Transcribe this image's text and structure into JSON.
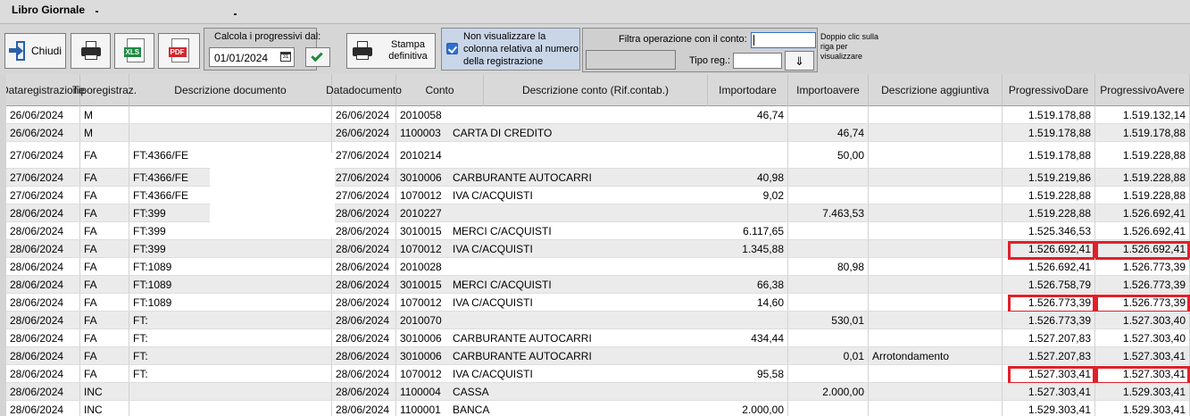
{
  "window": {
    "title": "Libro Giornale"
  },
  "toolbar": {
    "close_label": "Chiudi",
    "xls_tag": "XLS",
    "pdf_tag": "PDF",
    "progressive_group_label": "Calcola i progressivi dal:",
    "progressive_date": "01/01/2024",
    "final_print_label_1": "Stampa",
    "final_print_label_2": "definitiva",
    "hide_column_text_1": "Non visualizzare la",
    "hide_column_text_2": "colonna relativa al numero",
    "hide_column_text_3": "della registrazione",
    "filter_label": "Filtra operazione con il conto:",
    "type_reg_label": "Tipo reg.:",
    "hint_1": "Doppio clic sulla",
    "hint_2": "riga per",
    "hint_3": "visualizzare",
    "icons": [
      "exit-icon",
      "printer-icon",
      "excel-icon",
      "pdf-icon",
      "calendar-icon",
      "check-icon",
      "print-final-icon",
      "filter-icon"
    ]
  },
  "grid": {
    "columns": [
      {
        "l1": "Data",
        "l2": "registrazione"
      },
      {
        "l1": "Tipo",
        "l2": "registraz."
      },
      {
        "l1": "Descrizione documento",
        "l2": ""
      },
      {
        "l1": "Data",
        "l2": "documento"
      },
      {
        "l1": "Conto",
        "l2": ""
      },
      {
        "l1": "Descrizione conto (Rif.contab.)",
        "l2": ""
      },
      {
        "l1": "Importo",
        "l2": "dare"
      },
      {
        "l1": "Importo",
        "l2": "avere"
      },
      {
        "l1": "Descrizione aggiuntiva",
        "l2": ""
      },
      {
        "l1": "Progressivo",
        "l2": "Dare"
      },
      {
        "l1": "Progressivo",
        "l2": "Avere"
      }
    ],
    "rows": [
      {
        "reg": "26/06/2024",
        "tipo": "M",
        "desc": "",
        "doc": "26/06/2024",
        "conto": "2010058",
        "dconto": "",
        "dare": "46,74",
        "avere": "",
        "agg": "",
        "pdare": "1.519.178,88",
        "pavere": "1.519.132,14"
      },
      {
        "reg": "26/06/2024",
        "tipo": "M",
        "desc": "",
        "doc": "26/06/2024",
        "conto": "1100003",
        "dconto": "CARTA DI CREDITO",
        "dare": "",
        "avere": "46,74",
        "agg": "",
        "pdare": "1.519.178,88",
        "pavere": "1.519.178,88"
      },
      {
        "reg": "27/06/2024",
        "tipo": "FA",
        "desc": "FT:4366/FE",
        "doc": "27/06/2024",
        "conto": "2010214",
        "dconto": "",
        "dare": "",
        "avere": "50,00",
        "agg": "",
        "pdare": "1.519.178,88",
        "pavere": "1.519.228,88"
      },
      {
        "reg": "27/06/2024",
        "tipo": "FA",
        "desc": "FT:4366/FE",
        "doc": "27/06/2024",
        "conto": "3010006",
        "dconto": "CARBURANTE AUTOCARRI",
        "dare": "40,98",
        "avere": "",
        "agg": "",
        "pdare": "1.519.219,86",
        "pavere": "1.519.228,88"
      },
      {
        "reg": "27/06/2024",
        "tipo": "FA",
        "desc": "FT:4366/FE",
        "doc": "27/06/2024",
        "conto": "1070012",
        "dconto": "IVA C/ACQUISTI",
        "dare": "9,02",
        "avere": "",
        "agg": "",
        "pdare": "1.519.228,88",
        "pavere": "1.519.228,88"
      },
      {
        "reg": "28/06/2024",
        "tipo": "FA",
        "desc": "FT:399",
        "doc": "28/06/2024",
        "conto": "2010227",
        "dconto": "",
        "dare": "",
        "avere": "7.463,53",
        "agg": "",
        "pdare": "1.519.228,88",
        "pavere": "1.526.692,41"
      },
      {
        "reg": "28/06/2024",
        "tipo": "FA",
        "desc": "FT:399",
        "doc": "28/06/2024",
        "conto": "3010015",
        "dconto": "MERCI C/ACQUISTI",
        "dare": "6.117,65",
        "avere": "",
        "agg": "",
        "pdare": "1.525.346,53",
        "pavere": "1.526.692,41"
      },
      {
        "reg": "28/06/2024",
        "tipo": "FA",
        "desc": "FT:399",
        "doc": "28/06/2024",
        "conto": "1070012",
        "dconto": "IVA C/ACQUISTI",
        "dare": "1.345,88",
        "avere": "",
        "agg": "",
        "pdare": "1.526.692,41",
        "pavere": "1.526.692,41"
      },
      {
        "reg": "28/06/2024",
        "tipo": "FA",
        "desc": "FT:1089",
        "doc": "28/06/2024",
        "conto": "2010028",
        "dconto": "",
        "dare": "",
        "avere": "80,98",
        "agg": "",
        "pdare": "1.526.692,41",
        "pavere": "1.526.773,39"
      },
      {
        "reg": "28/06/2024",
        "tipo": "FA",
        "desc": "FT:1089",
        "doc": "28/06/2024",
        "conto": "3010015",
        "dconto": "MERCI C/ACQUISTI",
        "dare": "66,38",
        "avere": "",
        "agg": "",
        "pdare": "1.526.758,79",
        "pavere": "1.526.773,39"
      },
      {
        "reg": "28/06/2024",
        "tipo": "FA",
        "desc": "FT:1089",
        "doc": "28/06/2024",
        "conto": "1070012",
        "dconto": "IVA C/ACQUISTI",
        "dare": "14,60",
        "avere": "",
        "agg": "",
        "pdare": "1.526.773,39",
        "pavere": "1.526.773,39"
      },
      {
        "reg": "28/06/2024",
        "tipo": "FA",
        "desc": "FT:",
        "doc": "28/06/2024",
        "conto": "2010070",
        "dconto": "",
        "dare": "",
        "avere": "530,01",
        "agg": "",
        "pdare": "1.526.773,39",
        "pavere": "1.527.303,40"
      },
      {
        "reg": "28/06/2024",
        "tipo": "FA",
        "desc": "FT:",
        "doc": "28/06/2024",
        "conto": "3010006",
        "dconto": "CARBURANTE AUTOCARRI",
        "dare": "434,44",
        "avere": "",
        "agg": "",
        "pdare": "1.527.207,83",
        "pavere": "1.527.303,40"
      },
      {
        "reg": "28/06/2024",
        "tipo": "FA",
        "desc": "FT:",
        "doc": "28/06/2024",
        "conto": "3010006",
        "dconto": "CARBURANTE AUTOCARRI",
        "dare": "",
        "avere": "0,01",
        "agg": "Arrotondamento",
        "pdare": "1.527.207,83",
        "pavere": "1.527.303,41"
      },
      {
        "reg": "28/06/2024",
        "tipo": "FA",
        "desc": "FT:",
        "doc": "28/06/2024",
        "conto": "1070012",
        "dconto": "IVA C/ACQUISTI",
        "dare": "95,58",
        "avere": "",
        "agg": "",
        "pdare": "1.527.303,41",
        "pavere": "1.527.303,41"
      },
      {
        "reg": "28/06/2024",
        "tipo": "INC",
        "desc": "",
        "doc": "28/06/2024",
        "conto": "1100004",
        "dconto": "CASSA",
        "dare": "",
        "avere": "2.000,00",
        "agg": "",
        "pdare": "1.527.303,41",
        "pavere": "1.529.303,41"
      },
      {
        "reg": "28/06/2024",
        "tipo": "INC",
        "desc": "",
        "doc": "28/06/2024",
        "conto": "1100001",
        "dconto": "BANCA",
        "dare": "2.000,00",
        "avere": "",
        "agg": "",
        "pdare": "1.529.303,41",
        "pavere": "1.529.303,41"
      }
    ],
    "highlighted_rows": [
      7,
      10,
      14
    ],
    "highlight_color": "#e0202a"
  }
}
